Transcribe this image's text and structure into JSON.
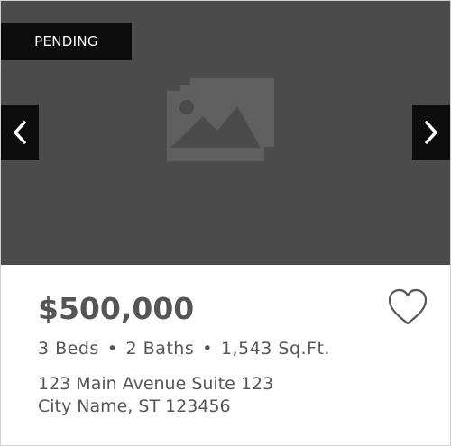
{
  "listing": {
    "status": "PENDING",
    "price": "$500,000",
    "beds": "3 Beds",
    "baths": "2 Baths",
    "sqft": "1,543 Sq.Ft.",
    "separator": "•",
    "address_line1": "123 Main Avenue Suite 123",
    "address_line2": "City Name, ST 123456"
  },
  "icons": {
    "prev": "chevron-left-icon",
    "next": "chevron-right-icon",
    "placeholder": "image-placeholder-icon",
    "favorite": "heart-outline-icon"
  },
  "colors": {
    "media_bg": "#4b4b4b",
    "badge_bg": "#0c0c0c",
    "text": "#555555"
  }
}
